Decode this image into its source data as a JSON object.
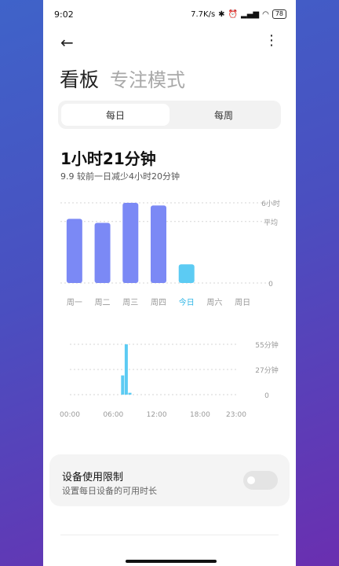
{
  "status_bar": {
    "time": "9:02",
    "net_speed": "7.7K/s",
    "battery": "78"
  },
  "title": {
    "active": "看板",
    "inactive": "专注模式"
  },
  "segmented": {
    "options": [
      "每日",
      "每周"
    ],
    "selected": "每日"
  },
  "summary": {
    "total": "1小时21分钟",
    "compare": "9.9 较前一日减少4小时20分钟"
  },
  "chart_data": [
    {
      "type": "bar",
      "categories": [
        "周一",
        "周二",
        "周三",
        "周四",
        "今日",
        "周六",
        "周日"
      ],
      "values": [
        4.8,
        4.5,
        6.0,
        5.8,
        1.4,
        null,
        null
      ],
      "y_labels": [
        "6小时",
        "平均",
        "0"
      ],
      "ylim": [
        0,
        6
      ],
      "average": 4.6,
      "highlight_index": 4,
      "colors": {
        "bar": "#7b89f5",
        "today": "#5ccbf3",
        "today_label": "#2fb6e6"
      }
    },
    {
      "type": "bar",
      "x_tick_labels": [
        "00:00",
        "06:00",
        "12:00",
        "18:00",
        "23:00"
      ],
      "y_labels": [
        "55分钟",
        "27分钟",
        "0"
      ],
      "ylim": [
        0,
        55
      ],
      "x": [
        7.3,
        7.8,
        8.3
      ],
      "values": [
        21,
        55,
        2
      ],
      "color": "#5ccbf3"
    }
  ],
  "limit_card": {
    "title": "设备使用限制",
    "subtitle": "设置每日设备的可用时长",
    "enabled": false
  }
}
